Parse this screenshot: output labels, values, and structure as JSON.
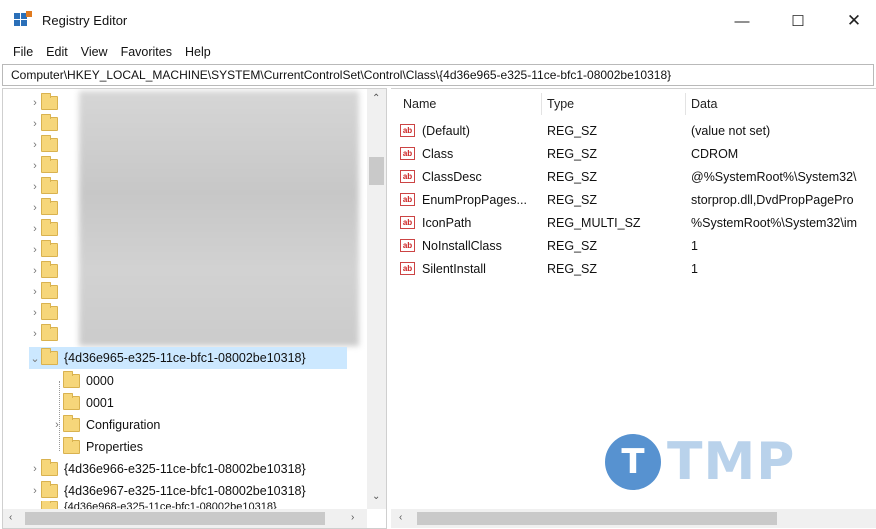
{
  "window": {
    "title": "Registry Editor",
    "minimize": "—",
    "maximize": "☐",
    "close": "✕"
  },
  "menu": [
    "File",
    "Edit",
    "View",
    "Favorites",
    "Help"
  ],
  "address": "Computer\\HKEY_LOCAL_MACHINE\\SYSTEM\\CurrentControlSet\\Control\\Class\\{4d36e965-e325-11ce-bfc1-08002be10318}",
  "tree": {
    "blurred_rows": 12,
    "selected": "{4d36e965-e325-11ce-bfc1-08002be10318}",
    "children": [
      "0000",
      "0001",
      "Configuration",
      "Properties"
    ],
    "siblings_after": [
      "{4d36e966-e325-11ce-bfc1-08002be10318}",
      "{4d36e967-e325-11ce-bfc1-08002be10318}",
      "{4d36e968-e325-11ce-bfc1-08002be10318}"
    ]
  },
  "columns": {
    "name": "Name",
    "type": "Type",
    "data": "Data"
  },
  "values": [
    {
      "name": "(Default)",
      "type": "REG_SZ",
      "data": "(value not set)"
    },
    {
      "name": "Class",
      "type": "REG_SZ",
      "data": "CDROM"
    },
    {
      "name": "ClassDesc",
      "type": "REG_SZ",
      "data": "@%SystemRoot%\\System32\\"
    },
    {
      "name": "EnumPropPages...",
      "type": "REG_SZ",
      "data": "storprop.dll,DvdPropPagePro"
    },
    {
      "name": "IconPath",
      "type": "REG_MULTI_SZ",
      "data": "%SystemRoot%\\System32\\im"
    },
    {
      "name": "NoInstallClass",
      "type": "REG_SZ",
      "data": "1"
    },
    {
      "name": "SilentInstall",
      "type": "REG_SZ",
      "data": "1"
    }
  ],
  "icons": {
    "value": "ab",
    "app": "registry-editor-icon"
  },
  "colors": {
    "selection": "#cce8ff",
    "folder": "#f6d67a",
    "watermark": "#3a80c8"
  },
  "watermark": {
    "letter": "T",
    "text": "TMP"
  }
}
